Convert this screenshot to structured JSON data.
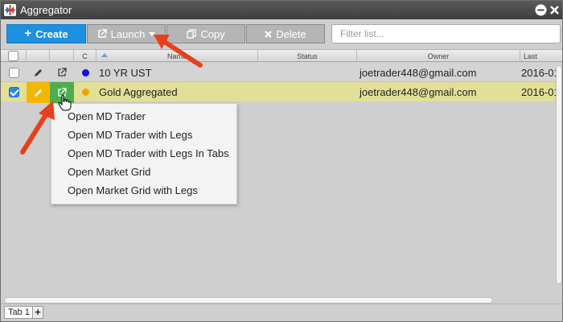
{
  "window": {
    "title": "Aggregator"
  },
  "icons": {
    "app": "aggregator-logo",
    "minimize": "minimize-icon",
    "close": "close-icon",
    "create": "plus-icon",
    "launch": "external-link-icon",
    "copy": "copy-icon",
    "delete": "x-icon",
    "edit": "pencil-icon",
    "launch_row": "external-link-icon",
    "cursor": "hand-pointer-icon"
  },
  "toolbar": {
    "create_label": "Create",
    "launch_label": "Launch",
    "copy_label": "Copy",
    "delete_label": "Delete",
    "filter_placeholder": "Filter list..."
  },
  "grid": {
    "headers": {
      "c": "C",
      "name": "Name",
      "status": "Status",
      "owner": "Owner",
      "last": "Last"
    },
    "rows": [
      {
        "checked": false,
        "color": "#1010e0",
        "name": "10 YR UST",
        "status": "",
        "owner": "joetrader448@gmail.com",
        "last": "2016-01"
      },
      {
        "checked": true,
        "color": "#f5a000",
        "name": "Gold Aggregated",
        "status": "",
        "owner": "joetrader448@gmail.com",
        "last": "2016-01"
      }
    ]
  },
  "launch_menu": {
    "items": [
      "Open MD Trader",
      "Open MD Trader with Legs",
      "Open MD Trader with Legs In Tabs",
      "Open Market Grid",
      "Open Market Grid with Legs"
    ]
  },
  "tabs": {
    "items": [
      "Tab 1"
    ],
    "add_label": "+"
  },
  "colors": {
    "create_button": "#1e90e0",
    "toolbar_button": "#b5b5b5",
    "selected_row": "#e2e096",
    "edit_active": "#f2b705",
    "launch_active": "#4cae4c",
    "annotation_arrow": "#e8401c"
  }
}
